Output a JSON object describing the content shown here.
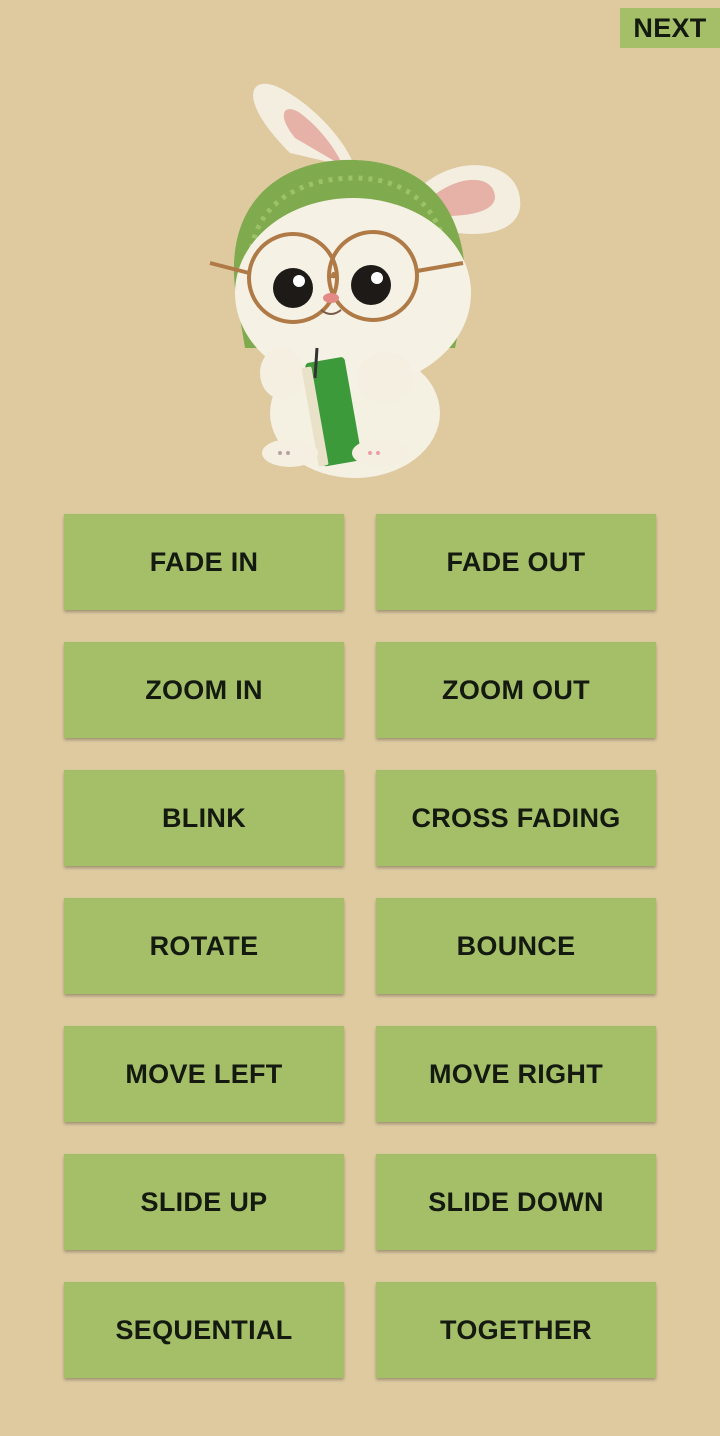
{
  "header": {
    "next_label": "NEXT"
  },
  "hero": {
    "image": "bunny-with-glasses-and-book-illustration"
  },
  "buttons": [
    "FADE IN",
    "FADE OUT",
    "ZOOM IN",
    "ZOOM OUT",
    "BLINK",
    "CROSS FADING",
    "ROTATE",
    "BOUNCE",
    "MOVE LEFT",
    "MOVE RIGHT",
    "SLIDE UP",
    "SLIDE DOWN",
    "SEQUENTIAL",
    "TOGETHER"
  ],
  "colors": {
    "background": "#dfcaa0",
    "button": "#a4bf68",
    "button_text": "#151a10"
  }
}
